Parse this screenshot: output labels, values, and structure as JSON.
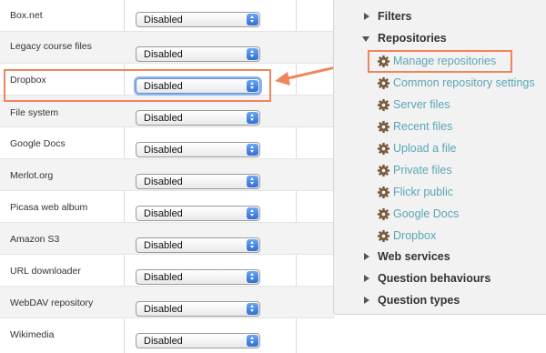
{
  "repositories_table": {
    "rows": [
      {
        "name": "Box.net",
        "status": "Disabled"
      },
      {
        "name": "Legacy course files",
        "status": "Disabled"
      },
      {
        "name": "Dropbox",
        "status": "Disabled"
      },
      {
        "name": "File system",
        "status": "Disabled"
      },
      {
        "name": "Google Docs",
        "status": "Disabled"
      },
      {
        "name": "Merlot.org",
        "status": "Disabled"
      },
      {
        "name": "Picasa web album",
        "status": "Disabled"
      },
      {
        "name": "Amazon S3",
        "status": "Disabled"
      },
      {
        "name": "URL downloader",
        "status": "Disabled"
      },
      {
        "name": "WebDAV repository",
        "status": "Disabled"
      },
      {
        "name": "Wikimedia",
        "status": "Disabled"
      }
    ]
  },
  "nav_tree": {
    "filters": "Filters",
    "repositories": "Repositories",
    "repo_links": [
      "Manage repositories",
      "Common repository settings",
      "Server files",
      "Recent files",
      "Upload a file",
      "Private files",
      "Flickr public",
      "Google Docs",
      "Dropbox"
    ],
    "web_services": "Web services",
    "question_behaviours": "Question behaviours",
    "question_types": "Question types"
  },
  "colors": {
    "highlight": "#f0855c",
    "link": "#5aa6b6",
    "gear": "#7a5a3c"
  }
}
